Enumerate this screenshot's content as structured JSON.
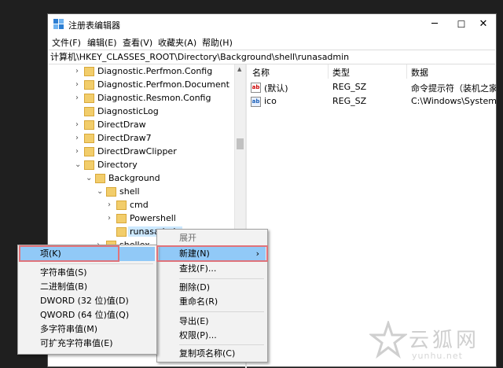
{
  "window": {
    "title": "注册表编辑器",
    "controls": {
      "minimize": "─",
      "maximize": "☐",
      "close": "✕"
    }
  },
  "menubar": [
    "文件(F)",
    "编辑(E)",
    "查看(V)",
    "收藏夹(A)",
    "帮助(H)"
  ],
  "address": "计算机\\HKEY_CLASSES_ROOT\\Directory\\Background\\shell\\runasadmin",
  "tree": [
    {
      "label": "Diagnostic.Perfmon.Config",
      "chevron": "›"
    },
    {
      "label": "Diagnostic.Perfmon.Document",
      "chevron": "›"
    },
    {
      "label": "Diagnostic.Resmon.Config",
      "chevron": "›"
    },
    {
      "label": "DiagnosticLog",
      "chevron": ""
    },
    {
      "label": "DirectDraw",
      "chevron": "›"
    },
    {
      "label": "DirectDraw7",
      "chevron": "›"
    },
    {
      "label": "DirectDrawClipper",
      "chevron": "›"
    },
    {
      "label": "Directory",
      "chevron": "⌄"
    },
    {
      "label": "Background",
      "chevron": "⌄"
    },
    {
      "label": "shell",
      "chevron": "⌄"
    },
    {
      "label": "cmd",
      "chevron": "›"
    },
    {
      "label": "Powershell",
      "chevron": "›"
    },
    {
      "label": "runasadmin",
      "chevron": ""
    },
    {
      "label": "shellex",
      "chevron": "›"
    }
  ],
  "list": {
    "headers": [
      "名称",
      "类型",
      "数据"
    ],
    "rows": [
      {
        "icon": "ab",
        "name": "(默认)",
        "type": "REG_SZ",
        "data": "命令提示符（装机之家)"
      },
      {
        "icon": "ab",
        "name": "ico",
        "type": "REG_SZ",
        "data": "C:\\Windows\\System3"
      }
    ]
  },
  "context_menu": {
    "items": [
      "展开",
      "新建(N)",
      "查找(F)...",
      "删除(D)",
      "重命名(R)",
      "导出(E)",
      "权限(P)...",
      "复制项名称(C)"
    ],
    "submenu_arrow": "›"
  },
  "new_submenu": {
    "items": [
      "项(K)",
      "字符串值(S)",
      "二进制值(B)",
      "DWORD (32 位)值(D)",
      "QWORD (64 位)值(Q)",
      "多字符串值(M)",
      "可扩充字符串值(E)"
    ]
  },
  "watermark": {
    "title": "云狐网",
    "url": "yunhu.net"
  }
}
